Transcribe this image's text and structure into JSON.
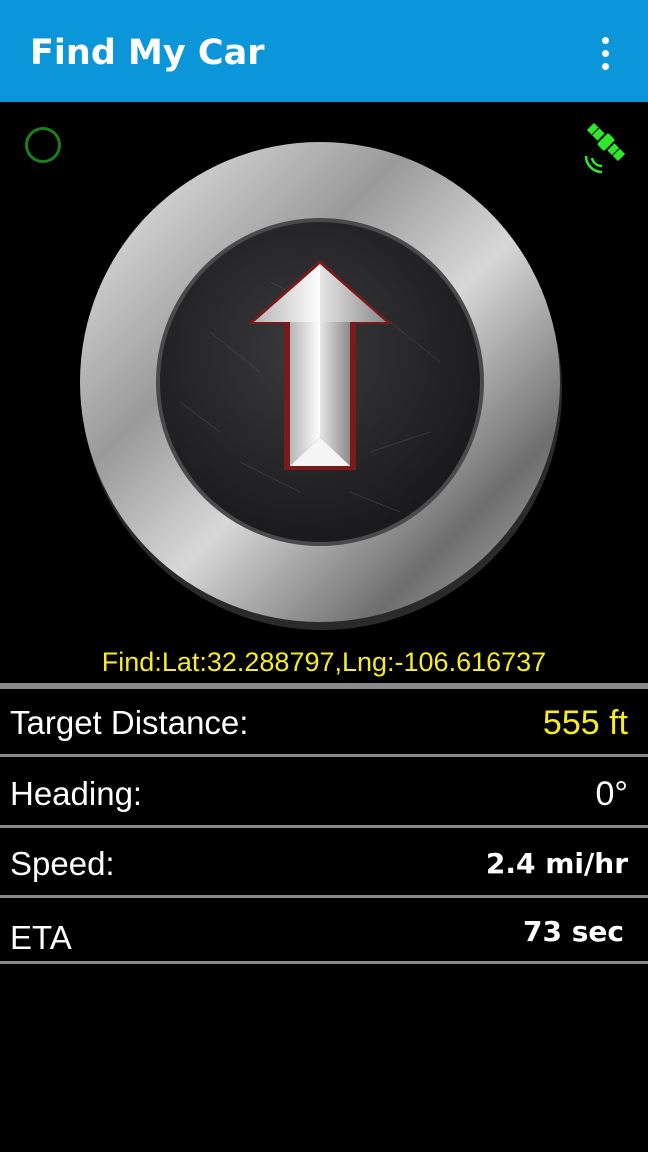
{
  "appbar": {
    "title": "Find My Car",
    "menu_icon": "overflow-menu-icon",
    "color": "#0a96d8"
  },
  "status": {
    "gps_indicator_icon": "status-ring-icon",
    "satellite_icon": "satellite-icon",
    "indicator_color": "#1b7f1b",
    "satellite_color": "#2ee82e"
  },
  "compass": {
    "arrow_icon": "direction-arrow-icon",
    "heading_deg": 0
  },
  "location": {
    "text": "Find:Lat:32.288797,Lng:-106.616737"
  },
  "stats": [
    {
      "label": "Target Distance:",
      "value": "555 ft"
    },
    {
      "label": "Heading:",
      "value": "0°"
    },
    {
      "label": "Speed:",
      "value": "2.4 mi/hr"
    },
    {
      "label": "ETA",
      "value": "73 sec"
    }
  ],
  "colors": {
    "highlight": "#f5ea2d",
    "background": "#000000",
    "divider": "#8a8a8a"
  }
}
